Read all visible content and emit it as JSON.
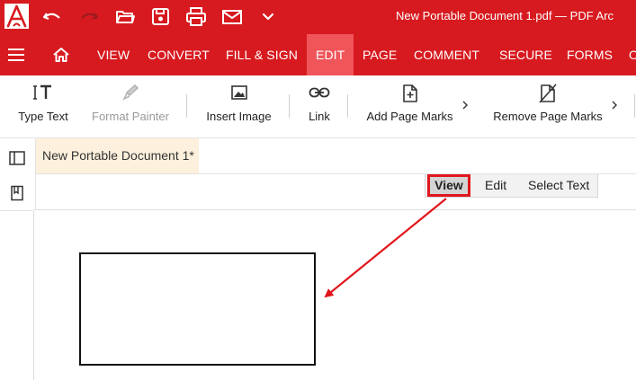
{
  "titlebar": {
    "title": "New Portable Document 1.pdf  —  PDF Arc",
    "icons": [
      "app-logo",
      "undo-icon",
      "redo-icon",
      "open-folder-icon",
      "save-icon",
      "print-icon",
      "mail-icon",
      "chevron-down-icon"
    ]
  },
  "menubar": {
    "items": [
      {
        "label": "VIEW"
      },
      {
        "label": "CONVERT"
      },
      {
        "label": "FILL & SIGN"
      },
      {
        "label": "EDIT"
      },
      {
        "label": "PAGE"
      },
      {
        "label": "COMMENT"
      },
      {
        "label": "SECURE"
      },
      {
        "label": "FORMS"
      },
      {
        "label": "O"
      }
    ],
    "active": "EDIT"
  },
  "toolbar": {
    "type_text": "Type Text",
    "format_painter": "Format Painter",
    "insert_image": "Insert Image",
    "link": "Link",
    "add_page_marks": "Add Page Marks",
    "remove_page_marks": "Remove Page Marks"
  },
  "document": {
    "tab_label": "New Portable Document 1*"
  },
  "modes": {
    "view": "View",
    "edit": "Edit",
    "select_text": "Select Text"
  },
  "colors": {
    "brand": "#d71a1f",
    "active_menu": "#f0555a",
    "annotation": "#e0161c",
    "doc_tab": "#fdf0dc"
  }
}
